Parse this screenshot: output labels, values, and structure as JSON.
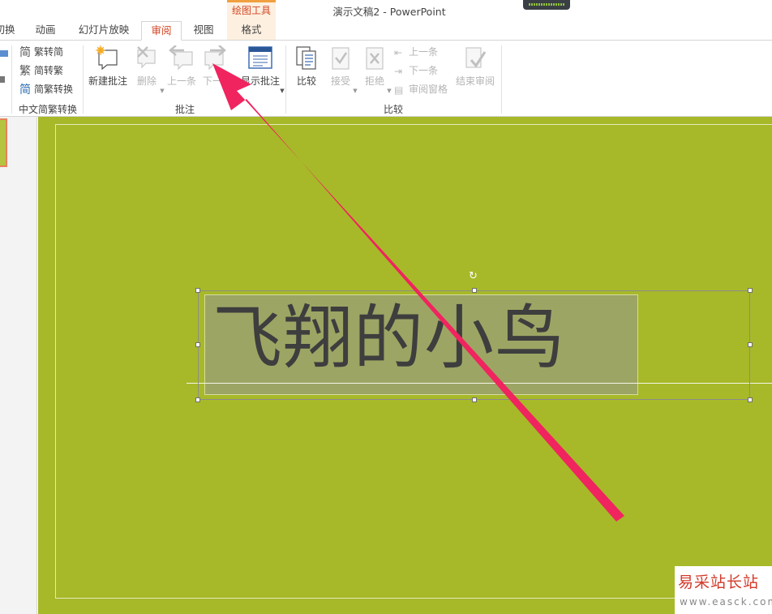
{
  "window": {
    "title": "演示文稿2 - PowerPoint",
    "context_tab_group": "绘图工具"
  },
  "tabs": [
    {
      "label": "切换",
      "visible_fragment": "切换"
    },
    {
      "label": "动画"
    },
    {
      "label": "幻灯片放映"
    },
    {
      "label": "审阅",
      "active": true
    },
    {
      "label": "视图"
    },
    {
      "label": "格式"
    }
  ],
  "ribbon": {
    "chinese_conversion": {
      "buttons": [
        "繁转简",
        "简转繁",
        "简繁转换"
      ],
      "group_label": "中文简繁转换"
    },
    "comments": {
      "buttons": [
        {
          "label": "新建批注",
          "enabled": true,
          "icon": "new-comment-icon"
        },
        {
          "label": "删除",
          "enabled": false,
          "icon": "delete-comment-icon"
        },
        {
          "label": "上一条",
          "enabled": false,
          "icon": "previous-comment-icon"
        },
        {
          "label": "下一条",
          "enabled": false,
          "icon": "next-comment-icon"
        },
        {
          "label": "显示批注",
          "enabled": true,
          "icon": "show-comments-icon"
        }
      ],
      "group_label": "批注"
    },
    "compare": {
      "buttons": [
        {
          "label": "比较",
          "enabled": true
        },
        {
          "label": "接受",
          "enabled": false
        },
        {
          "label": "拒绝",
          "enabled": false
        },
        {
          "label": "上一条",
          "enabled": false
        },
        {
          "label": "下一条",
          "enabled": false
        },
        {
          "label": "审阅窗格",
          "enabled": false
        },
        {
          "label": "结束审阅",
          "enabled": false
        }
      ],
      "group_label": "比较"
    }
  },
  "slide": {
    "text": "飞翔的小鸟",
    "background_color": "#a7b928",
    "text_color": "#3e3e3e"
  },
  "annotation": {
    "arrow_color": "#f0245f",
    "points_to": "previous-comment-button"
  },
  "watermark": {
    "title": "易采站长站",
    "url": "www.easck.com"
  }
}
